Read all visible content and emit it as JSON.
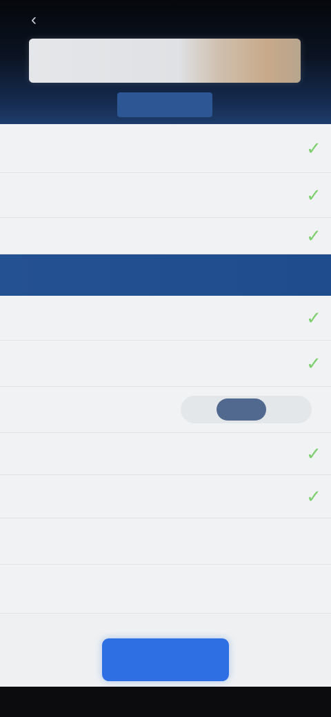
{
  "header": {
    "back_glyph": "‹",
    "banner_text": "",
    "section_title": ""
  },
  "rows_top": [
    {
      "label": "",
      "checked": true,
      "height": 70
    },
    {
      "label": "",
      "checked": true,
      "height": 64
    },
    {
      "label": "",
      "checked": true,
      "height": 52
    }
  ],
  "group": {
    "label": ""
  },
  "rows_bottom": [
    {
      "label": "",
      "type": "check",
      "checked": true,
      "height": 64
    },
    {
      "label": "",
      "type": "check",
      "checked": true,
      "height": 66
    },
    {
      "label": "",
      "type": "segment",
      "segment_value": "",
      "height": 66
    },
    {
      "label": "",
      "type": "check",
      "checked": true,
      "height": 60
    },
    {
      "label": "",
      "type": "check",
      "checked": true,
      "height": 62
    },
    {
      "label": "",
      "type": "plain",
      "height": 66
    },
    {
      "label": "",
      "type": "plain",
      "height": 70
    }
  ],
  "footer": {
    "primary_button_label": ""
  },
  "colors": {
    "accent_blue": "#2e6fe3",
    "header_blue": "#245192",
    "check_green": "#7ccf6c"
  },
  "icons": {
    "check": "check-icon",
    "back": "back-arrow-icon"
  }
}
